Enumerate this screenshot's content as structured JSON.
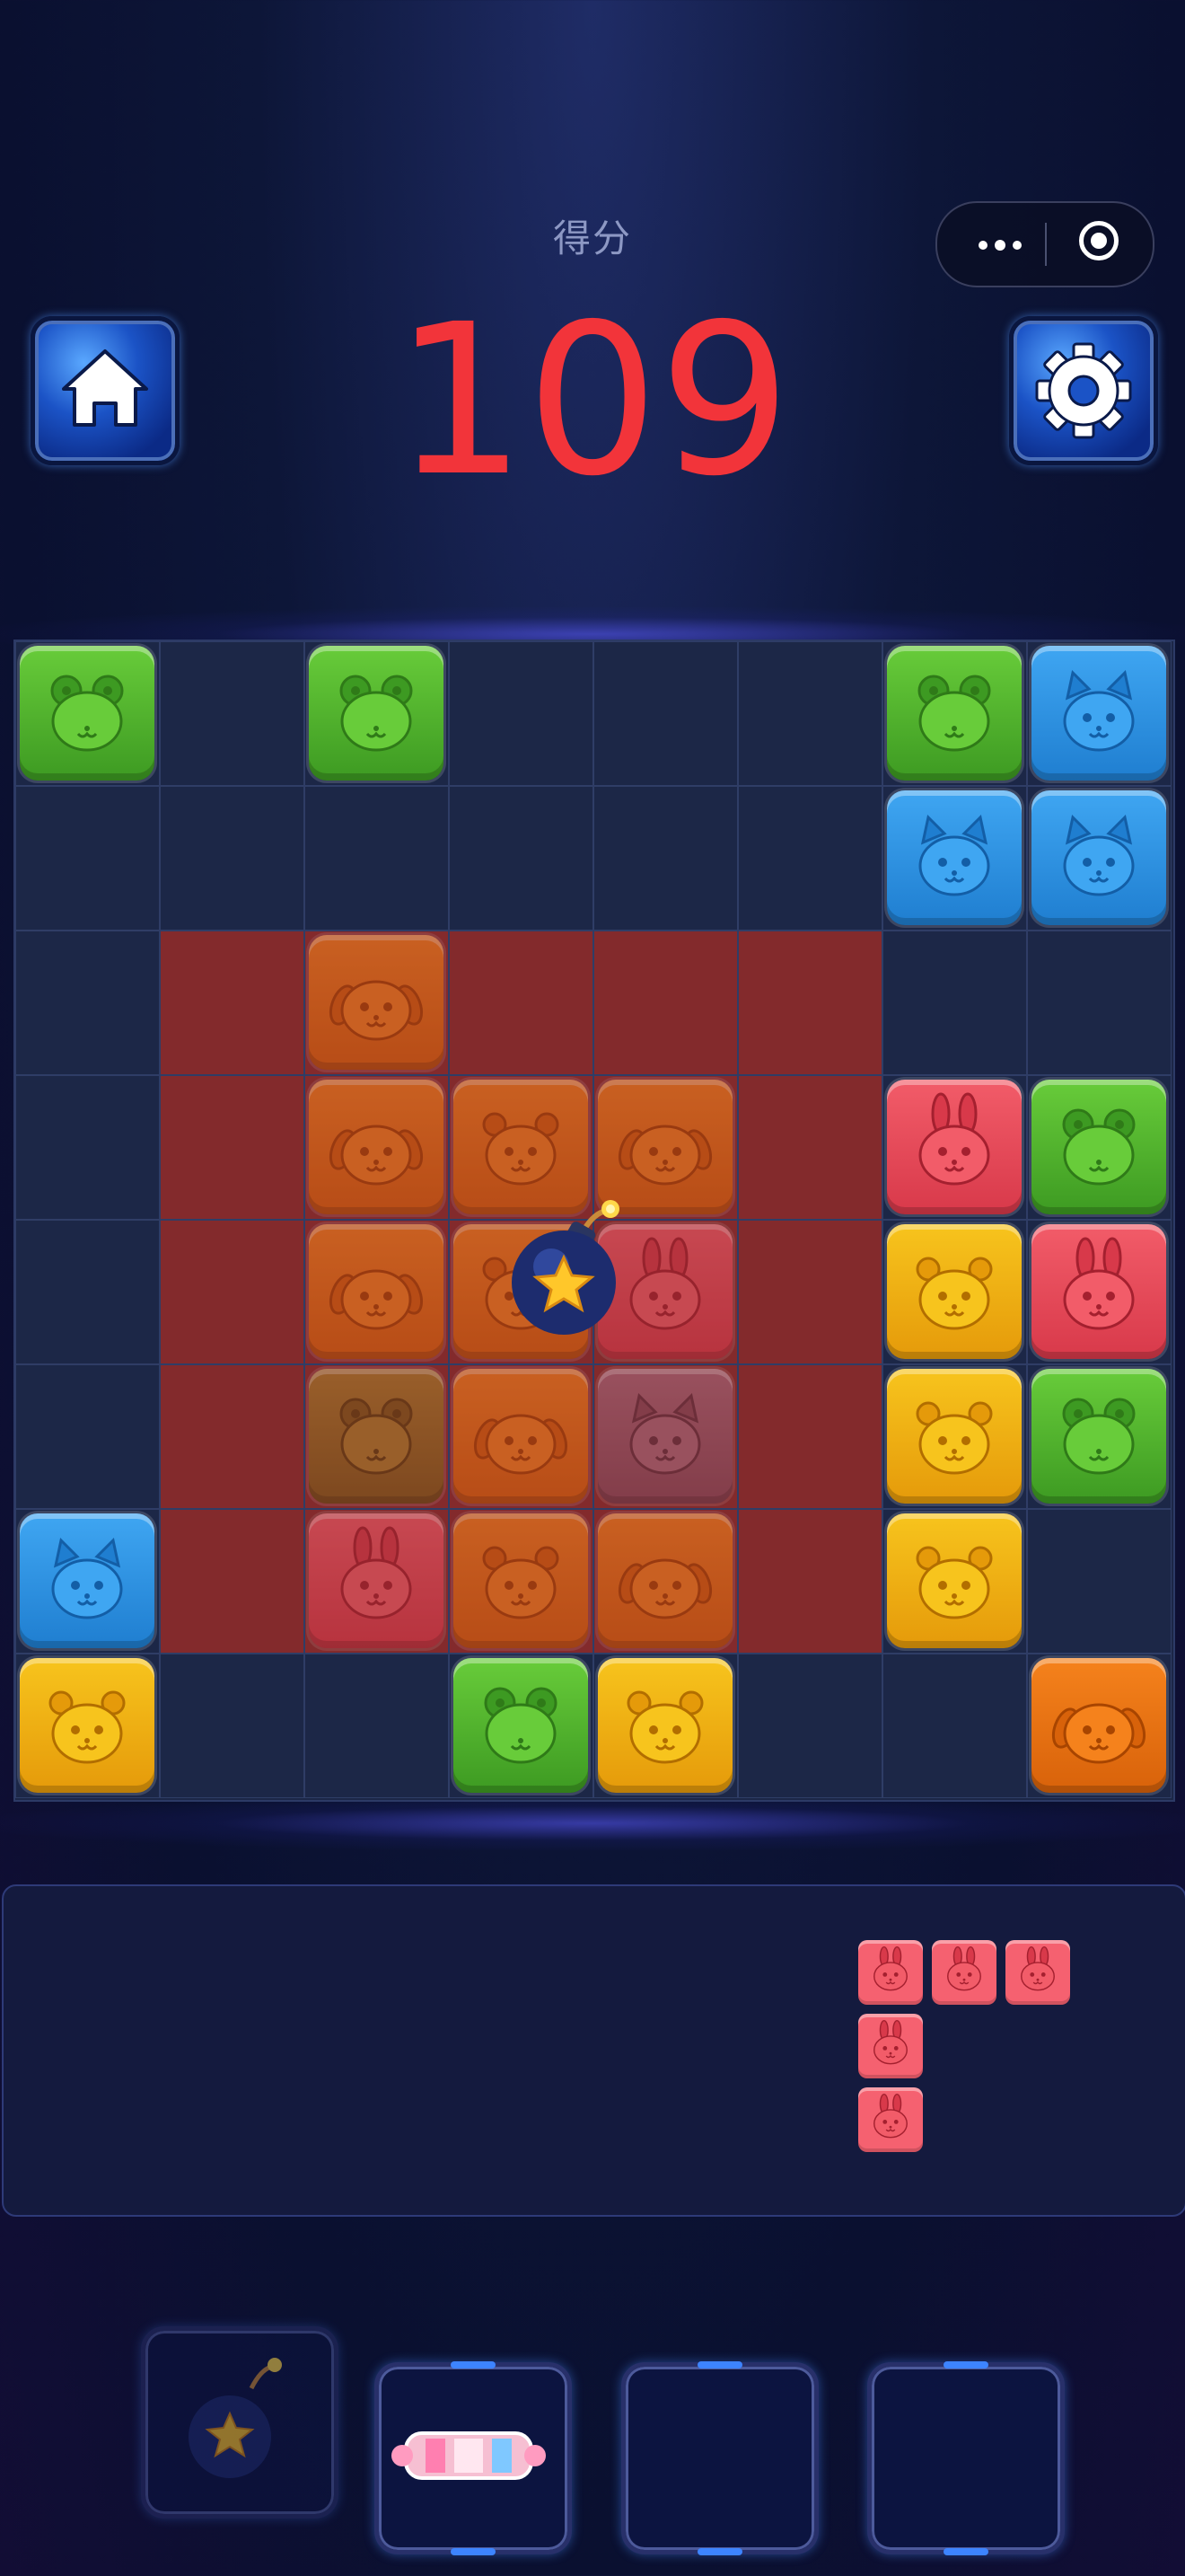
{
  "header": {
    "score_label": "得分",
    "score_value": "109",
    "home_icon": "home-icon",
    "settings_icon": "gear-icon",
    "capsule_icons": [
      "more-dots-icon",
      "target-circle-icon"
    ]
  },
  "colors": {
    "score": "#f2343a",
    "green": "#68cc3a",
    "blue": "#3fa6f2",
    "red": "#f25c69",
    "yellow": "#f7c41d",
    "orange": "#f5821c",
    "highlight": "#832a2c",
    "cell": "#1c2747"
  },
  "board": {
    "rows": 8,
    "cols": 8,
    "tiles": [
      {
        "r": 0,
        "c": 0,
        "animal": "frog",
        "color": "green"
      },
      {
        "r": 0,
        "c": 2,
        "animal": "frog",
        "color": "green"
      },
      {
        "r": 0,
        "c": 6,
        "animal": "frog",
        "color": "green"
      },
      {
        "r": 0,
        "c": 7,
        "animal": "cat",
        "color": "blue"
      },
      {
        "r": 1,
        "c": 6,
        "animal": "cat",
        "color": "blue"
      },
      {
        "r": 1,
        "c": 7,
        "animal": "cat",
        "color": "blue"
      },
      {
        "r": 2,
        "c": 2,
        "animal": "dog",
        "color": "orange",
        "dim": true
      },
      {
        "r": 3,
        "c": 2,
        "animal": "dog",
        "color": "orange",
        "dim": true
      },
      {
        "r": 3,
        "c": 3,
        "animal": "bear",
        "color": "orange",
        "dim": true
      },
      {
        "r": 3,
        "c": 4,
        "animal": "dog",
        "color": "orange",
        "dim": true
      },
      {
        "r": 3,
        "c": 6,
        "animal": "rabbit",
        "color": "red"
      },
      {
        "r": 3,
        "c": 7,
        "animal": "frog",
        "color": "green"
      },
      {
        "r": 4,
        "c": 2,
        "animal": "dog",
        "color": "orange",
        "dim": true
      },
      {
        "r": 4,
        "c": 3,
        "animal": "bear",
        "color": "orange",
        "dim": true
      },
      {
        "r": 4,
        "c": 4,
        "animal": "rabbit",
        "color": "red",
        "dim": true
      },
      {
        "r": 4,
        "c": 6,
        "animal": "bear",
        "color": "yellow"
      },
      {
        "r": 4,
        "c": 7,
        "animal": "rabbit",
        "color": "red"
      },
      {
        "r": 5,
        "c": 2,
        "animal": "frog",
        "color": "olive",
        "dim": true
      },
      {
        "r": 5,
        "c": 3,
        "animal": "dog",
        "color": "orange",
        "dim": true
      },
      {
        "r": 5,
        "c": 4,
        "animal": "cat",
        "color": "mauve",
        "dim": true
      },
      {
        "r": 5,
        "c": 6,
        "animal": "bear",
        "color": "yellow"
      },
      {
        "r": 5,
        "c": 7,
        "animal": "frog",
        "color": "green"
      },
      {
        "r": 6,
        "c": 0,
        "animal": "cat",
        "color": "blue"
      },
      {
        "r": 6,
        "c": 2,
        "animal": "rabbit",
        "color": "red",
        "dim": true
      },
      {
        "r": 6,
        "c": 3,
        "animal": "bear",
        "color": "orange",
        "dim": true
      },
      {
        "r": 6,
        "c": 4,
        "animal": "dog",
        "color": "orange",
        "dim": true
      },
      {
        "r": 6,
        "c": 6,
        "animal": "bear",
        "color": "yellow"
      },
      {
        "r": 7,
        "c": 0,
        "animal": "bear",
        "color": "yellow"
      },
      {
        "r": 7,
        "c": 3,
        "animal": "frog",
        "color": "green"
      },
      {
        "r": 7,
        "c": 4,
        "animal": "bear",
        "color": "yellow"
      },
      {
        "r": 7,
        "c": 7,
        "animal": "dog",
        "color": "orange"
      }
    ],
    "highlight_rows": [
      2,
      3,
      4,
      5,
      6
    ],
    "highlight_cols": [
      1,
      2,
      3,
      4,
      5
    ],
    "bomb_icon": "bomb-star-icon"
  },
  "tray": {
    "piece": {
      "animal": "rabbit",
      "color": "red",
      "cells": [
        [
          0,
          0
        ],
        [
          0,
          1
        ],
        [
          0,
          2
        ],
        [
          1,
          0
        ],
        [
          2,
          0
        ]
      ]
    }
  },
  "powerups": [
    {
      "name": "bomb",
      "icon": "bomb-star-icon",
      "state": "inactive"
    },
    {
      "name": "candy",
      "icon": "candy-rocket-icon",
      "state": "active"
    },
    {
      "name": "empty",
      "icon": "",
      "state": "active"
    },
    {
      "name": "empty",
      "icon": "",
      "state": "active"
    }
  ]
}
